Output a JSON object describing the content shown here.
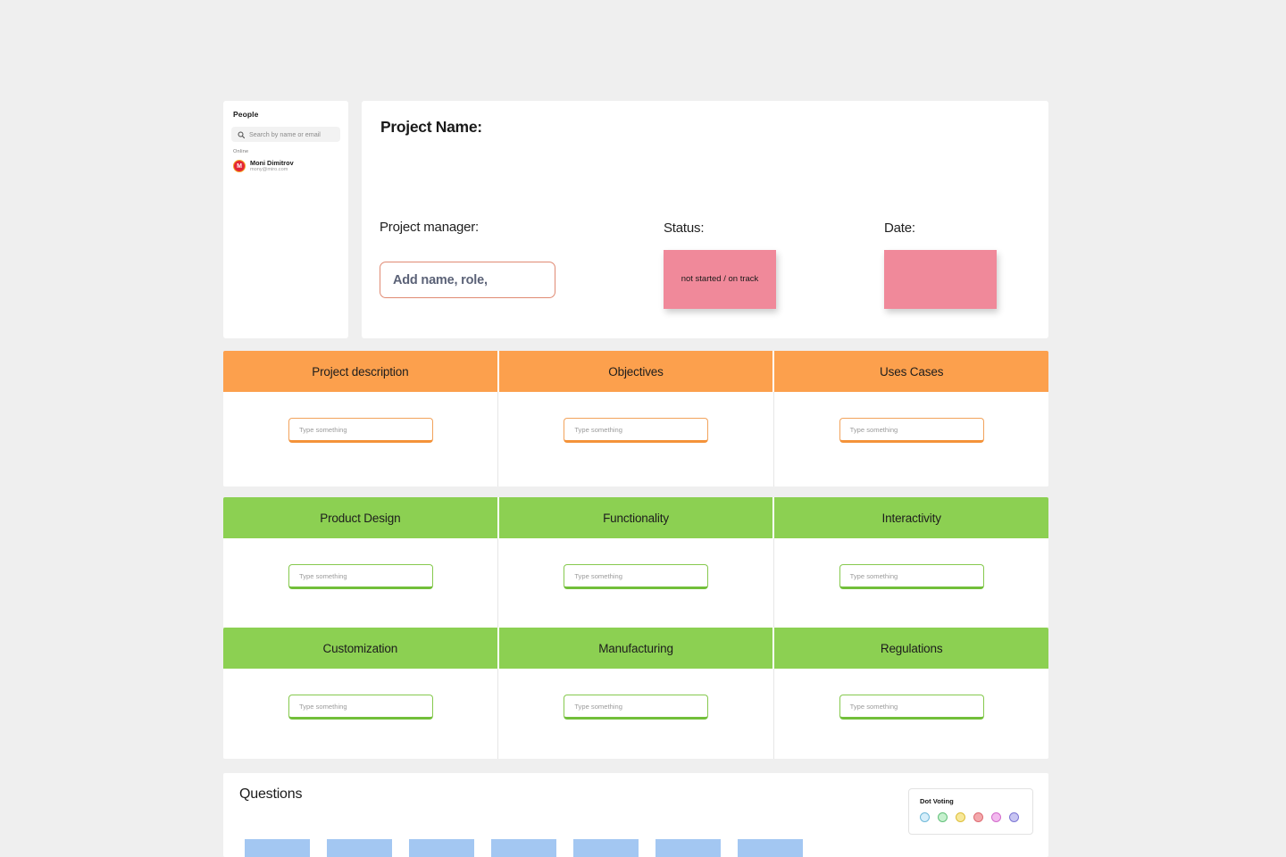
{
  "canvas": {
    "background_color": "#EFEFEF"
  },
  "people_panel": {
    "title": "People",
    "search": {
      "placeholder": "Search by name or email",
      "icon": "search-icon"
    },
    "online_label": "Online",
    "members": [
      {
        "initial": "M",
        "name": "Moni Dimitrov",
        "email": "mony@miro.com",
        "avatar_color": "#E32636",
        "avatar_ring_color": "#F6A623"
      }
    ]
  },
  "project_header": {
    "title": "Project Name:",
    "manager_label": "Project manager:",
    "manager_input": {
      "value": "Add name, role,",
      "border_color": "#E08A73"
    },
    "status_label": "Status:",
    "status_note": {
      "text": "not started / on track",
      "color": "#F0899A"
    },
    "date_label": "Date:",
    "date_note": {
      "text": "",
      "color": "#F0899A"
    }
  },
  "sections": [
    {
      "id": "orange-section",
      "header_color": "#FCA04D",
      "input_style": "orange",
      "columns": [
        {
          "header": "Project description",
          "input_placeholder": "Type something"
        },
        {
          "header": "Objectives",
          "input_placeholder": "Type something"
        },
        {
          "header": "Uses Cases",
          "input_placeholder": "Type something"
        }
      ]
    },
    {
      "id": "green-section-1",
      "header_color": "#8CD052",
      "input_style": "green",
      "columns": [
        {
          "header": "Product Design",
          "input_placeholder": "Type something"
        },
        {
          "header": "Functionality",
          "input_placeholder": "Type something"
        },
        {
          "header": "Interactivity",
          "input_placeholder": "Type something"
        }
      ]
    },
    {
      "id": "green-section-2",
      "header_color": "#8CD052",
      "input_style": "green",
      "columns": [
        {
          "header": "Customization",
          "input_placeholder": "Type something"
        },
        {
          "header": "Manufacturing",
          "input_placeholder": "Type something"
        },
        {
          "header": "Regulations",
          "input_placeholder": "Type something"
        }
      ]
    }
  ],
  "questions": {
    "title": "Questions",
    "note_color": "#A3C7F2",
    "notes_count": 7
  },
  "dot_voting": {
    "title": "Dot Voting",
    "dots": [
      {
        "name": "blue",
        "fill": "#D6EEFA",
        "stroke": "#6FB8D8"
      },
      {
        "name": "green",
        "fill": "#C6F0CE",
        "stroke": "#63C07A"
      },
      {
        "name": "yellow",
        "fill": "#F7E89A",
        "stroke": "#DDBE3A"
      },
      {
        "name": "red",
        "fill": "#F3A8AC",
        "stroke": "#DE6B72"
      },
      {
        "name": "pink",
        "fill": "#F2B9EE",
        "stroke": "#D26BCB"
      },
      {
        "name": "purple",
        "fill": "#C8C5F2",
        "stroke": "#7D77D4"
      }
    ]
  }
}
